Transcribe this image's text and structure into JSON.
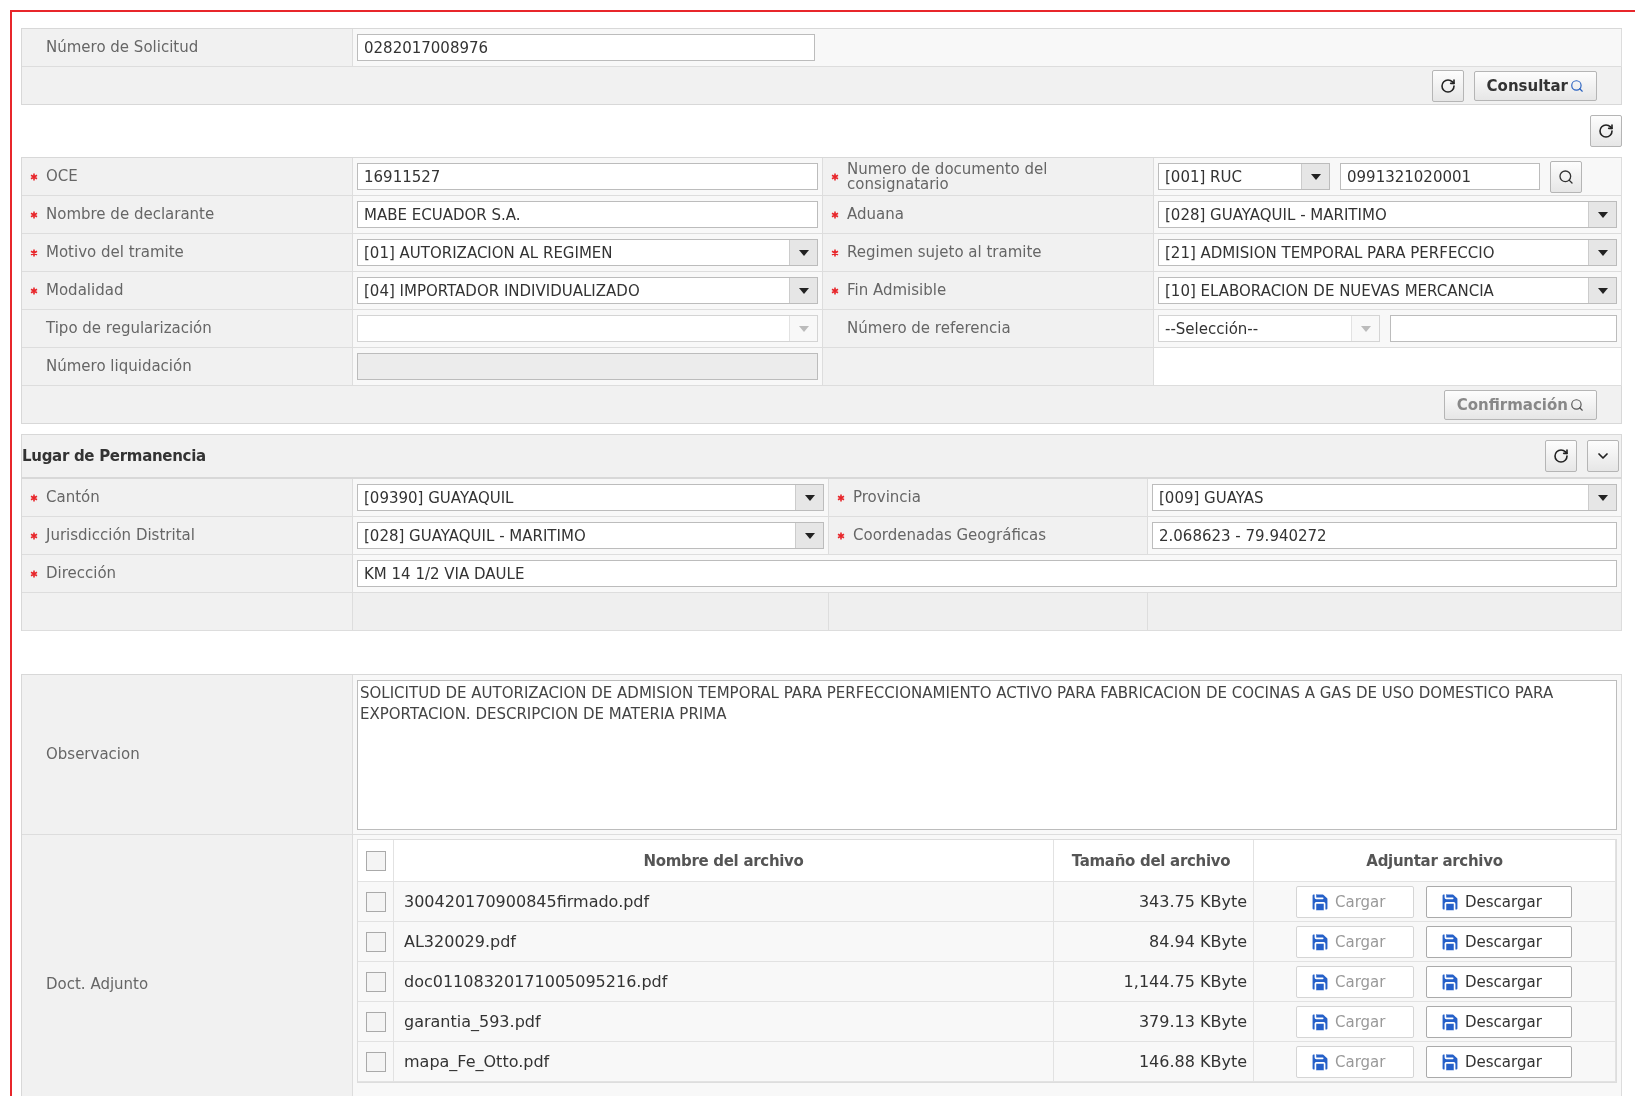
{
  "request": {
    "label": "Número de Solicitud",
    "value": "0282017008976",
    "buttons": [
      {
        "label": "Consultar",
        "disabled": false
      }
    ]
  },
  "form": {
    "rows": [
      {
        "left": {
          "label": "OCE",
          "required": true,
          "kind": "text",
          "value": "16911527",
          "disabled": false
        },
        "right": {
          "label": "Numero de documento del consignatario",
          "required": true,
          "kind": "select_text",
          "value": "[001] RUC",
          "text": "0991321020001",
          "disabled": false
        }
      },
      {
        "left": {
          "label": "Nombre de declarante",
          "required": true,
          "kind": "text",
          "value": "MABE ECUADOR S.A.",
          "disabled": false
        },
        "right": {
          "label": "Aduana",
          "required": true,
          "kind": "select",
          "value": "[028] GUAYAQUIL - MARITIMO",
          "disabled": false
        }
      },
      {
        "left": {
          "label": "Motivo del tramite",
          "required": true,
          "kind": "select",
          "value": "[01] AUTORIZACION AL REGIMEN",
          "disabled": false
        },
        "right": {
          "label": "Regimen sujeto al tramite",
          "required": true,
          "kind": "select",
          "value": "[21] ADMISION TEMPORAL PARA PERFECCIO",
          "disabled": false
        }
      },
      {
        "left": {
          "label": "Modalidad",
          "required": true,
          "kind": "select",
          "value": "[04] IMPORTADOR INDIVIDUALIZADO",
          "disabled": false
        },
        "right": {
          "label": "Fin Admisible",
          "required": true,
          "kind": "select",
          "value": "[10] ELABORACION DE NUEVAS MERCANCIA",
          "disabled": false
        }
      },
      {
        "left": {
          "label": "Tipo de regularización",
          "required": false,
          "kind": "select",
          "disabled": true
        },
        "right": {
          "label": "Número de referencia",
          "required": false,
          "kind": "select_text",
          "value": "--Selección--",
          "disabled": true
        }
      },
      {
        "left": {
          "label": "Número liquidación",
          "required": false,
          "kind": "text",
          "disabled": true
        }
      }
    ],
    "buttons": [
      {
        "label": "Confirmación",
        "disabled": true
      }
    ]
  },
  "location": {
    "title": "Lugar de Permanencia",
    "expanded": true,
    "rows": [
      {
        "left": {
          "label": "Cantón",
          "required": true,
          "kind": "select",
          "value": "[09390] GUAYAQUIL",
          "disabled": false
        },
        "right": {
          "label": "Provincia",
          "required": true,
          "kind": "select",
          "value": "[009] GUAYAS",
          "disabled": false
        }
      },
      {
        "left": {
          "label": "Jurisdicción Distrital",
          "required": true,
          "kind": "select",
          "value": "[028] GUAYAQUIL - MARITIMO",
          "disabled": false
        },
        "right": {
          "label": "Coordenadas Geográficas",
          "required": true,
          "kind": "text",
          "value": "2.068623 - 79.940272",
          "disabled": false
        }
      },
      {
        "left": {
          "label": "Dirección",
          "required": true,
          "kind": "wide_text",
          "value": "KM 14 1/2 VIA DAULE",
          "disabled": false
        }
      }
    ]
  },
  "observation": {
    "label": "Observacion",
    "value": "SOLICITUD DE AUTORIZACION DE ADMISION TEMPORAL PARA PERFECCIONAMIENTO ACTIVO PARA FABRICACION DE COCINAS A GAS DE USO DOMESTICO PARA EXPORTACION. DESCRIPCION DE MATERIA PRIMA"
  },
  "attachments": {
    "label": "Doct. Adjunto",
    "all_checked": false,
    "columns": [
      "Nombre del archivo",
      "Tamaño del archivo",
      "Adjuntar archivo"
    ],
    "rows": [
      {
        "checked": false,
        "name": "300420170900845firmado.pdf",
        "size": "343.75 KByte",
        "actions": [
          {
            "label": "Cargar",
            "disabled": true
          },
          {
            "label": "Descargar",
            "disabled": false
          }
        ]
      },
      {
        "checked": false,
        "name": "AL320029.pdf",
        "size": "84.94 KByte",
        "actions": [
          {
            "label": "Cargar",
            "disabled": true
          },
          {
            "label": "Descargar",
            "disabled": false
          }
        ]
      },
      {
        "checked": false,
        "name": "doc01108320171005095216.pdf",
        "size": "1,144.75 KByte",
        "actions": [
          {
            "label": "Cargar",
            "disabled": true
          },
          {
            "label": "Descargar",
            "disabled": false
          }
        ]
      },
      {
        "checked": false,
        "name": "garantia_593.pdf",
        "size": "379.13 KByte",
        "actions": [
          {
            "label": "Cargar",
            "disabled": true
          },
          {
            "label": "Descargar",
            "disabled": false
          }
        ]
      },
      {
        "checked": false,
        "name": "mapa_Fe_Otto.pdf",
        "size": "146.88 KByte",
        "actions": [
          {
            "label": "Cargar",
            "disabled": true
          },
          {
            "label": "Descargar",
            "disabled": false
          }
        ]
      }
    ]
  }
}
